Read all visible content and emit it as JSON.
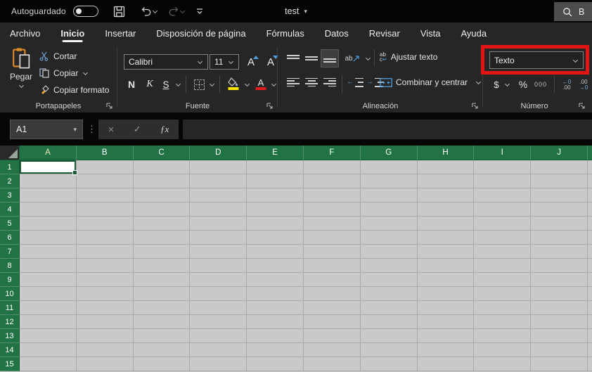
{
  "titlebar": {
    "autosave_label": "Autoguardado",
    "autosave_state": "off",
    "doc_title": "test",
    "search_text": "B"
  },
  "tabs": [
    {
      "label": "Archivo"
    },
    {
      "label": "Inicio",
      "active": true
    },
    {
      "label": "Insertar"
    },
    {
      "label": "Disposición de página"
    },
    {
      "label": "Fórmulas"
    },
    {
      "label": "Datos"
    },
    {
      "label": "Revisar"
    },
    {
      "label": "Vista"
    },
    {
      "label": "Ayuda"
    }
  ],
  "ribbon": {
    "clipboard": {
      "group_label": "Portapapeles",
      "paste_label": "Pegar",
      "cut_label": "Cortar",
      "copy_label": "Copiar",
      "format_painter_label": "Copiar formato"
    },
    "font": {
      "group_label": "Fuente",
      "family": "Calibri",
      "size": "11",
      "bold_label": "N",
      "italic_label": "K",
      "underline_label": "S"
    },
    "alignment": {
      "group_label": "Alineación",
      "orientation_label": "ab",
      "wrap_text_label": "Ajustar texto",
      "merge_center_label": "Combinar y centrar"
    },
    "number": {
      "group_label": "Número",
      "format_value": "Texto",
      "currency_label": "$",
      "percent_label": "%",
      "thousands_label": "000",
      "increase_decimal_top": "←0",
      "increase_decimal_bottom": ".00",
      "decrease_decimal_top": ".00",
      "decrease_decimal_bottom": "→0",
      "annotation": {
        "shape": "red-box",
        "color": "#e31414"
      }
    }
  },
  "formula_bar": {
    "name_box": "A1",
    "cancel_icon": "×",
    "enter_icon": "✓",
    "fx_icon": "ƒx",
    "dots_icon": "⋮"
  },
  "icons": {
    "caret": "▾"
  },
  "grid": {
    "columns": [
      "A",
      "B",
      "C",
      "D",
      "E",
      "F",
      "G",
      "H",
      "I",
      "J"
    ],
    "rows": [
      "1",
      "2",
      "3",
      "4",
      "5",
      "6",
      "7",
      "8",
      "9",
      "10",
      "11",
      "12",
      "13",
      "14",
      "15"
    ],
    "selected_cell": "A1"
  },
  "colors": {
    "excel_green": "#217346",
    "annotation_red": "#e31414",
    "accent_blue": "#4f9dde",
    "fill_yellow": "#ffe600",
    "font_red": "#e01b1b",
    "clipboard_orange": "#d9882a"
  }
}
